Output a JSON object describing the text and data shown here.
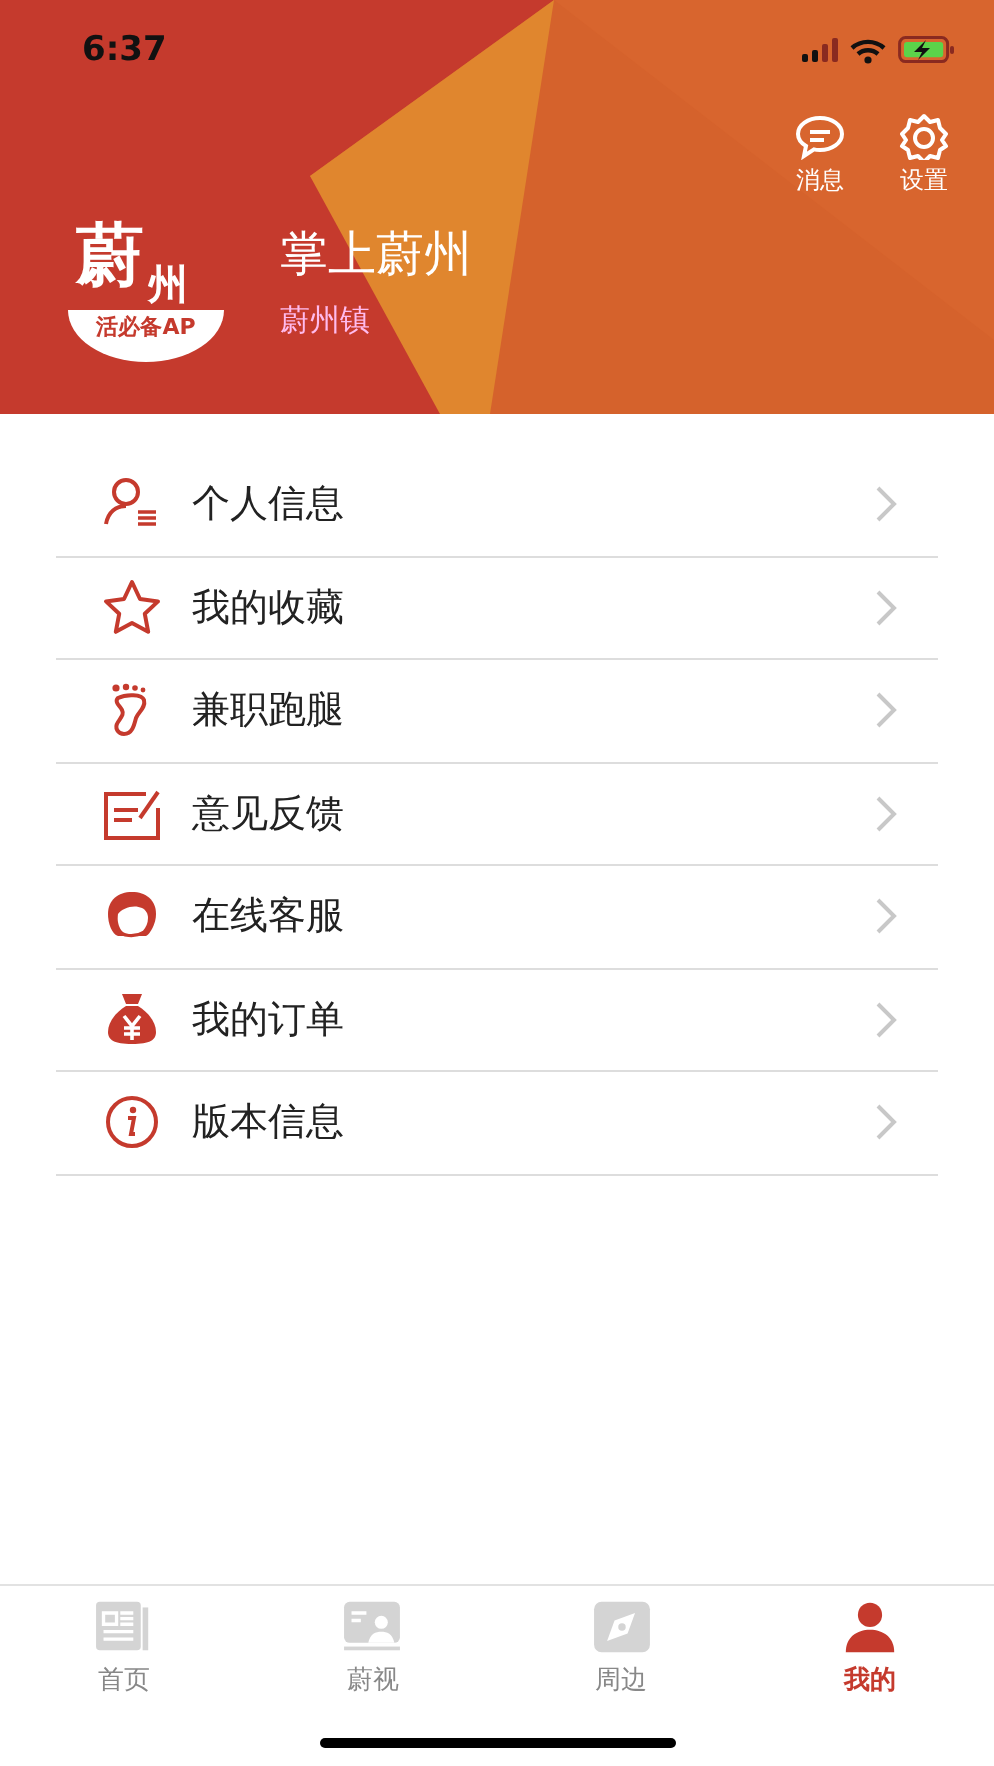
{
  "status_bar": {
    "time": "6:37"
  },
  "header": {
    "actions": [
      {
        "kind": "message",
        "label": "消息"
      },
      {
        "kind": "settings",
        "label": "设置"
      }
    ],
    "logo": {
      "glyph_1": "蔚",
      "glyph_2": "州",
      "banner": "活必备AP"
    },
    "title": "掌上蔚州",
    "subtitle": "蔚州镇"
  },
  "menu": [
    {
      "kind": "profile",
      "label": "个人信息"
    },
    {
      "kind": "star",
      "label": "我的收藏"
    },
    {
      "kind": "foot",
      "label": "兼职跑腿"
    },
    {
      "kind": "feedback",
      "label": "意见反馈"
    },
    {
      "kind": "service",
      "label": "在线客服"
    },
    {
      "kind": "moneybag",
      "label": "我的订单"
    },
    {
      "kind": "info",
      "label": "版本信息"
    }
  ],
  "tab_bar": [
    {
      "kind": "news",
      "label": "首页",
      "selected": false
    },
    {
      "kind": "video",
      "label": "蔚视",
      "selected": false
    },
    {
      "kind": "compass",
      "label": "周边",
      "selected": false
    },
    {
      "kind": "person",
      "label": "我的",
      "selected": true
    }
  ]
}
